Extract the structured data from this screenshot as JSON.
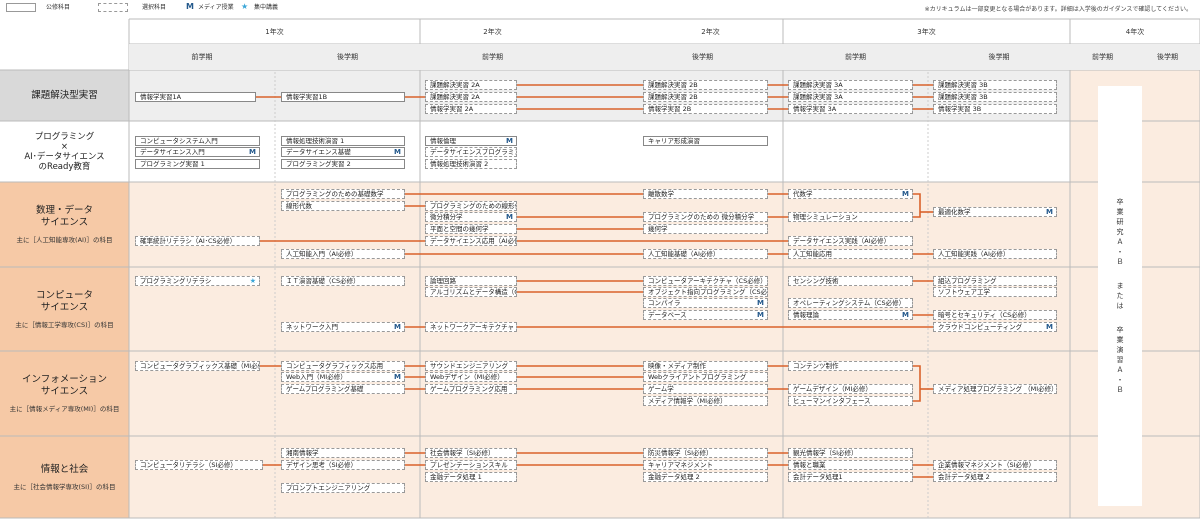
{
  "legend": {
    "required": "公修科目",
    "elective": "選択科目",
    "media_mark": "M",
    "media": "メディア授業",
    "star_mark": "★",
    "intensive": "集中講義"
  },
  "note": "※カリキュラムは一部変更となる場合があります。詳細は入学後のガイダンスで確認してください。",
  "years": [
    "1年次",
    "2年次",
    "2年次",
    "3年次",
    "4年次"
  ],
  "terms": [
    "前学期",
    "後学期",
    "前学期",
    "後学期",
    "前学期",
    "後学期",
    "前学期",
    "後学期"
  ],
  "rows": [
    {
      "title": "課題解決型実習",
      "sub": ""
    },
    {
      "title": "プログラミング\n×\nAI･データサイエンス\nのReady教育",
      "sub": ""
    },
    {
      "title": "数理・データ\nサイエンス",
      "sub": "主に［人工知能専攻(AI)］の科目"
    },
    {
      "title": "コンピュータ\nサイエンス",
      "sub": "主に［情報工学専攻(CS)］の科目"
    },
    {
      "title": "インフォメーション\nサイエンス",
      "sub": "主に［情報メディア専攻(MI)］の科目"
    },
    {
      "title": "情報と社会",
      "sub": "主に［社会情報学専攻(SI)］の科目"
    }
  ],
  "graduation": {
    "line1": [
      "卒",
      "業",
      "研",
      "究",
      "Ａ",
      "・",
      "Ｂ"
    ],
    "or": [
      "ま",
      "た",
      "は"
    ],
    "line2": [
      "卒",
      "業",
      "演",
      "習",
      "Ａ",
      "・",
      "Ｂ"
    ]
  },
  "courses": [
    {
      "name": "情報学実習1A",
      "type": "req",
      "mark": ""
    },
    {
      "name": "情報学実習1B",
      "type": "req",
      "mark": ""
    },
    {
      "name": "課題解決実習 2A",
      "type": "ele",
      "mark": ""
    },
    {
      "name": "課題解決実習 2A",
      "type": "ele",
      "mark": ""
    },
    {
      "name": "情報学実習 2A",
      "type": "ele",
      "mark": ""
    },
    {
      "name": "課題解決実習 2B",
      "type": "ele",
      "mark": ""
    },
    {
      "name": "課題解決実習 2B",
      "type": "ele",
      "mark": ""
    },
    {
      "name": "情報学実習 2B",
      "type": "ele",
      "mark": ""
    },
    {
      "name": "課題解決実習 3A",
      "type": "ele",
      "mark": ""
    },
    {
      "name": "課題解決実習 3A",
      "type": "ele",
      "mark": ""
    },
    {
      "name": "情報学実習 3A",
      "type": "ele",
      "mark": ""
    },
    {
      "name": "課題解決実習 3B",
      "type": "ele",
      "mark": ""
    },
    {
      "name": "課題解決実習 3B",
      "type": "ele",
      "mark": ""
    },
    {
      "name": "情報学実習 3B",
      "type": "ele",
      "mark": ""
    },
    {
      "name": "コンピュータシステム入門",
      "type": "req",
      "mark": ""
    },
    {
      "name": "データサイエンス入門",
      "type": "req",
      "mark": "M"
    },
    {
      "name": "プログラミング実習 1",
      "type": "req",
      "mark": ""
    },
    {
      "name": "情報処理技術演習 1",
      "type": "req",
      "mark": ""
    },
    {
      "name": "データサイエンス基礎",
      "type": "req",
      "mark": "M"
    },
    {
      "name": "プログラミング実習 2",
      "type": "req",
      "mark": ""
    },
    {
      "name": "情報倫理",
      "type": "req",
      "mark": "M"
    },
    {
      "name": "データサイエンスプログラミング",
      "type": "ele",
      "mark": ""
    },
    {
      "name": "情報処理技術演習 2",
      "type": "ele",
      "mark": ""
    },
    {
      "name": "キャリア形成演習",
      "type": "req",
      "mark": ""
    },
    {
      "name": "プログラミングのための基礎数学",
      "type": "ele",
      "mark": ""
    },
    {
      "name": "線形代数",
      "type": "ele",
      "mark": ""
    },
    {
      "name": "プログラミングのための線形代数",
      "type": "ele",
      "mark": ""
    },
    {
      "name": "微分積分学",
      "type": "ele",
      "mark": "M"
    },
    {
      "name": "平面と空間の幾何学",
      "type": "ele",
      "mark": ""
    },
    {
      "name": "データサイエンス応用（AI必修）",
      "type": "ele",
      "mark": ""
    },
    {
      "name": "確率統計リテラシ（AI･CS必修）",
      "type": "ele",
      "mark": ""
    },
    {
      "name": "人工知能入門（AI必修）",
      "type": "ele",
      "mark": ""
    },
    {
      "name": "離散数学",
      "type": "ele",
      "mark": ""
    },
    {
      "name": "プログラミングのための 微分積分学",
      "type": "ele",
      "mark": ""
    },
    {
      "name": "幾何学",
      "type": "ele",
      "mark": ""
    },
    {
      "name": "人工知能基礎（AI必修）",
      "type": "ele",
      "mark": ""
    },
    {
      "name": "代数学",
      "type": "ele",
      "mark": "M"
    },
    {
      "name": "物理シミュレーション",
      "type": "ele",
      "mark": ""
    },
    {
      "name": "データサイエンス実践（AI必修）",
      "type": "ele",
      "mark": ""
    },
    {
      "name": "人工知能応用",
      "type": "ele",
      "mark": ""
    },
    {
      "name": "最適化数学",
      "type": "ele",
      "mark": "M"
    },
    {
      "name": "人工知能実践（AI必修）",
      "type": "ele",
      "mark": ""
    },
    {
      "name": "プログラミングリテラシ",
      "type": "ele",
      "mark": "★"
    },
    {
      "name": "ＩＴ演習基礎（CS必修）",
      "type": "ele",
      "mark": ""
    },
    {
      "name": "ネットワーク入門",
      "type": "ele",
      "mark": "M"
    },
    {
      "name": "論理回路",
      "type": "ele",
      "mark": ""
    },
    {
      "name": "アルゴリズムとデータ構造（CS必修）",
      "type": "ele",
      "mark": ""
    },
    {
      "name": "ネットワークアーキテクチャ（CS必修）",
      "type": "ele",
      "mark": ""
    },
    {
      "name": "コンピュータアーキテクチャ（CS必修）",
      "type": "ele",
      "mark": ""
    },
    {
      "name": "オブジェクト指向プログラミング（CS必修）",
      "type": "ele",
      "mark": ""
    },
    {
      "name": "コンパイラ",
      "type": "ele",
      "mark": "M"
    },
    {
      "name": "データベース",
      "type": "ele",
      "mark": "M"
    },
    {
      "name": "センシング技術",
      "type": "ele",
      "mark": ""
    },
    {
      "name": "オペレーティングシステム（CS必修）",
      "type": "ele",
      "mark": ""
    },
    {
      "name": "情報理論",
      "type": "ele",
      "mark": "M"
    },
    {
      "name": "組込プログラミング",
      "type": "ele",
      "mark": ""
    },
    {
      "name": "ソフトウェア工学",
      "type": "ele",
      "mark": ""
    },
    {
      "name": "暗号とセキュリティ（CS必修）",
      "type": "ele",
      "mark": ""
    },
    {
      "name": "クラウドコンピューティング",
      "type": "ele",
      "mark": "M"
    },
    {
      "name": "コンピュータグラフィックス基礎（MI必修）",
      "type": "ele",
      "mark": ""
    },
    {
      "name": "コンピュータグラフィックス応用",
      "type": "ele",
      "mark": ""
    },
    {
      "name": "Web入門（MI必修）",
      "type": "ele",
      "mark": "M"
    },
    {
      "name": "ゲームプログラミング基礎",
      "type": "ele",
      "mark": ""
    },
    {
      "name": "サウンドエンジニアリング",
      "type": "ele",
      "mark": ""
    },
    {
      "name": "Webデザイン（MI必修）",
      "type": "ele",
      "mark": ""
    },
    {
      "name": "ゲームプログラミング応用",
      "type": "ele",
      "mark": ""
    },
    {
      "name": "映像・メディア制作",
      "type": "ele",
      "mark": ""
    },
    {
      "name": "Webクライアントプログラミング",
      "type": "ele",
      "mark": ""
    },
    {
      "name": "ゲーム学",
      "type": "ele",
      "mark": ""
    },
    {
      "name": "メディア情報学（MI必修）",
      "type": "ele",
      "mark": ""
    },
    {
      "name": "コンテンツ制作",
      "type": "ele",
      "mark": ""
    },
    {
      "name": "ゲームデザイン（MI必修）",
      "type": "ele",
      "mark": ""
    },
    {
      "name": "ヒューマンインタフェース",
      "type": "ele",
      "mark": ""
    },
    {
      "name": "メディア処理プログラミング （MI必修）",
      "type": "ele",
      "mark": ""
    },
    {
      "name": "コンピュータリテラシ（SI必修）",
      "type": "ele",
      "mark": ""
    },
    {
      "name": "湘南情報学",
      "type": "ele",
      "mark": ""
    },
    {
      "name": "デザイン思考（SI必修）",
      "type": "ele",
      "mark": ""
    },
    {
      "name": "プロンプトエンジニアリング",
      "type": "ele",
      "mark": ""
    },
    {
      "name": "社会情報学（SI必修）",
      "type": "ele",
      "mark": ""
    },
    {
      "name": "プレゼンテーションスキル",
      "type": "ele",
      "mark": ""
    },
    {
      "name": "金融データ処理 1",
      "type": "ele",
      "mark": ""
    },
    {
      "name": "防災情報学（SI必修）",
      "type": "ele",
      "mark": ""
    },
    {
      "name": "キャリアマネジメント",
      "type": "ele",
      "mark": ""
    },
    {
      "name": "金融データ処理 2",
      "type": "ele",
      "mark": ""
    },
    {
      "name": "観光情報学（SI必修）",
      "type": "ele",
      "mark": ""
    },
    {
      "name": "情報と職業",
      "type": "ele",
      "mark": ""
    },
    {
      "name": "会計データ処理1",
      "type": "ele",
      "mark": ""
    },
    {
      "name": "企業情報マネジメント（SI必修）",
      "type": "ele",
      "mark": ""
    },
    {
      "name": "会計データ処理 2",
      "type": "ele",
      "mark": ""
    }
  ]
}
